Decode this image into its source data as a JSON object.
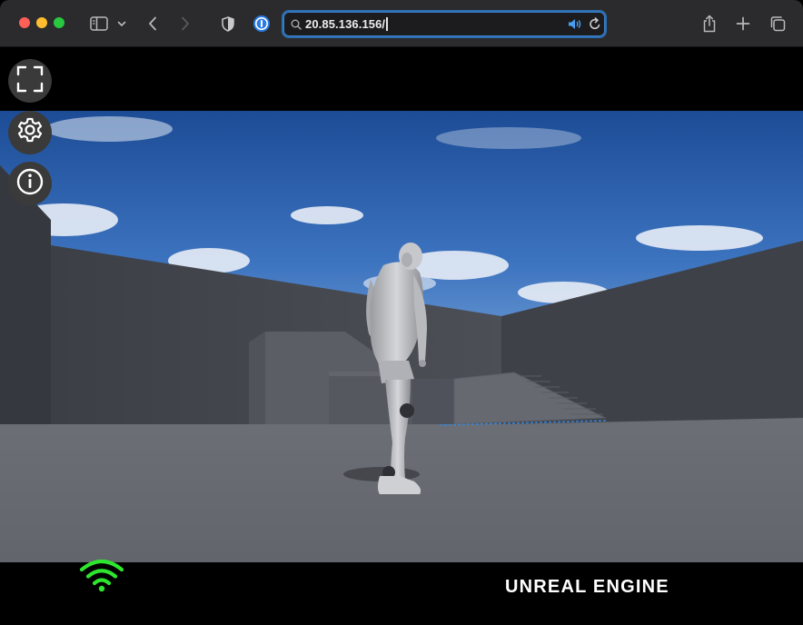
{
  "browser": {
    "address_bar": {
      "value": "20.85.136.156/"
    }
  },
  "overlay": {
    "buttons": [
      {
        "name": "fullscreen",
        "icon": "fullscreen-icon"
      },
      {
        "name": "settings",
        "icon": "gear-icon"
      },
      {
        "name": "info",
        "icon": "info-icon"
      }
    ],
    "connection_indicator": {
      "icon": "wifi-icon",
      "color": "#2ee62e"
    },
    "brand_logo": "UNREAL ENGINE"
  },
  "colors": {
    "toolbar_bg": "#2b2b2d",
    "url_focus_ring": "#2c6fb3",
    "sky_top": "#1f4f9a",
    "wall": "#4a4d54",
    "floor": "#6a6d74"
  }
}
